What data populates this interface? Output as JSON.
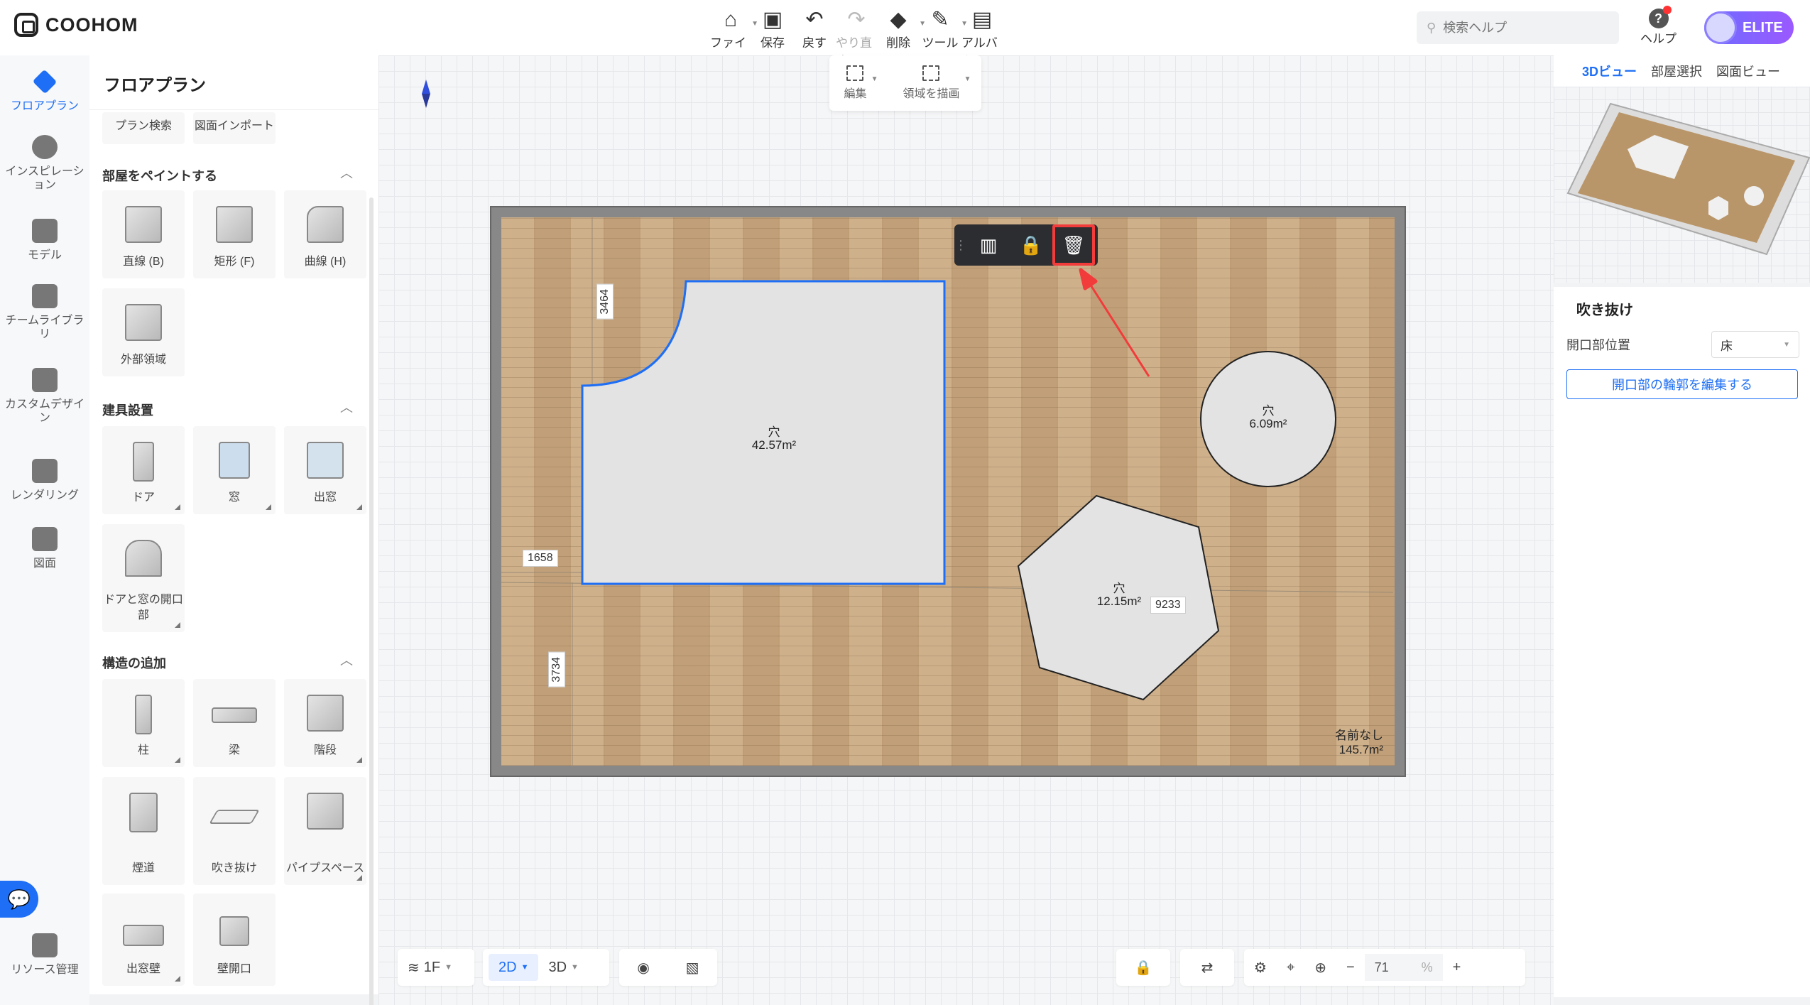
{
  "app": {
    "brand": "COOHOM"
  },
  "toolbar": {
    "items": [
      {
        "label": "ファイル",
        "icon": "home-icon"
      },
      {
        "label": "保存",
        "icon": "save-icon"
      },
      {
        "label": "戻す",
        "icon": "undo-icon"
      },
      {
        "label": "やり直す",
        "icon": "redo-icon"
      },
      {
        "label": "削除",
        "icon": "eraser-icon"
      },
      {
        "label": "ツール",
        "icon": "wrench-icon"
      },
      {
        "label": "アルバム",
        "icon": "album-icon"
      }
    ],
    "search_placeholder": "検索ヘルプ",
    "help_label": "ヘルプ",
    "elite_label": "ELITE"
  },
  "leftnav": [
    {
      "label": "フロアプラン"
    },
    {
      "label": "インスピレーション"
    },
    {
      "label": "モデル"
    },
    {
      "label": "チームライブラリ"
    },
    {
      "label": "カスタムデザイン"
    },
    {
      "label": "レンダリング"
    },
    {
      "label": "図面"
    },
    {
      "label": "リソース管理"
    }
  ],
  "panel": {
    "title": "フロアプラン",
    "top_items": [
      "プラン検索",
      "図面インポート"
    ],
    "sections": [
      {
        "title": "部屋をペイントする",
        "items": [
          "直線 (B)",
          "矩形 (F)",
          "曲線 (H)",
          "外部領域"
        ]
      },
      {
        "title": "建具設置",
        "items": [
          "ドア",
          "窓",
          "出窓",
          "ドアと窓の開口部"
        ]
      },
      {
        "title": "構造の追加",
        "items": [
          "柱",
          "梁",
          "階段",
          "煙道",
          "吹き抜け",
          "パイプスペース",
          "出窓壁",
          "壁開口"
        ]
      }
    ]
  },
  "subbar": {
    "edit": "編集",
    "draw": "領域を描画"
  },
  "canvas": {
    "holes": [
      {
        "name": "穴",
        "area": "42.57m²"
      },
      {
        "name": "穴",
        "area": "6.09m²"
      },
      {
        "name": "穴",
        "area": "12.15m²"
      }
    ],
    "dimensions": [
      "3464",
      "1658",
      "3734",
      "9233"
    ],
    "room_name": "名前なし",
    "room_area": "145.7m²"
  },
  "bottom": {
    "floor": "1F",
    "mode2d": "2D",
    "mode3d": "3D",
    "zoom": "71",
    "zoom_unit": "%"
  },
  "right": {
    "tabs": [
      "3Dビュー",
      "部屋選択",
      "図面ビュー"
    ],
    "props_title": "吹き抜け",
    "position_label": "開口部位置",
    "position_value": "床",
    "edit_outline_button": "開口部の輪郭を編集する"
  },
  "colors": {
    "accent": "#1e6ff5",
    "highlight": "#f23b3b"
  }
}
